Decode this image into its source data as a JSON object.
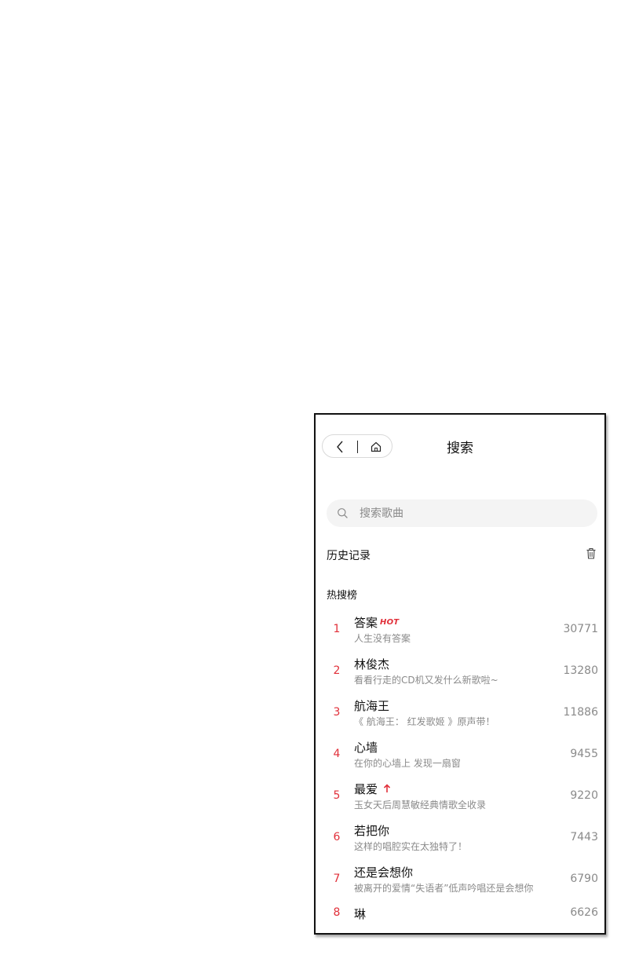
{
  "header": {
    "title": "搜索",
    "back_icon": "chevron-left-icon",
    "home_icon": "home-icon"
  },
  "search": {
    "placeholder": "搜索歌曲",
    "icon": "search-icon"
  },
  "history": {
    "label": "历史记录",
    "clear_icon": "trash-icon"
  },
  "hot": {
    "title": "热搜榜",
    "items": [
      {
        "rank": "1",
        "name": "答案",
        "badge": "HOT",
        "desc": "人生没有答案",
        "score": "30771"
      },
      {
        "rank": "2",
        "name": "林俊杰",
        "desc": "看看行走的CD机又发什么新歌啦~",
        "score": "13280"
      },
      {
        "rank": "3",
        "name": "航海王",
        "desc": "《 航海王： 红发歌姬 》原声带！",
        "score": "11886"
      },
      {
        "rank": "4",
        "name": "心墙",
        "desc": "在你的心墙上 发现一扇窗",
        "score": "9455"
      },
      {
        "rank": "5",
        "name": "最爱",
        "trend_icon": "arrow-up-icon",
        "desc": "玉女天后周慧敏经典情歌全收录",
        "score": "9220"
      },
      {
        "rank": "6",
        "name": "若把你",
        "desc": "这样的唱腔实在太独特了！",
        "score": "7443"
      },
      {
        "rank": "7",
        "name": "还是会想你",
        "desc": "被离开的爱情“失语者”低声吟唱还是会想你",
        "score": "6790"
      },
      {
        "rank": "8",
        "name": "琳",
        "score": "6626"
      }
    ]
  },
  "colors": {
    "accent": "#e1303a",
    "muted": "#8a8a8a",
    "search_bg": "#f4f4f4"
  }
}
